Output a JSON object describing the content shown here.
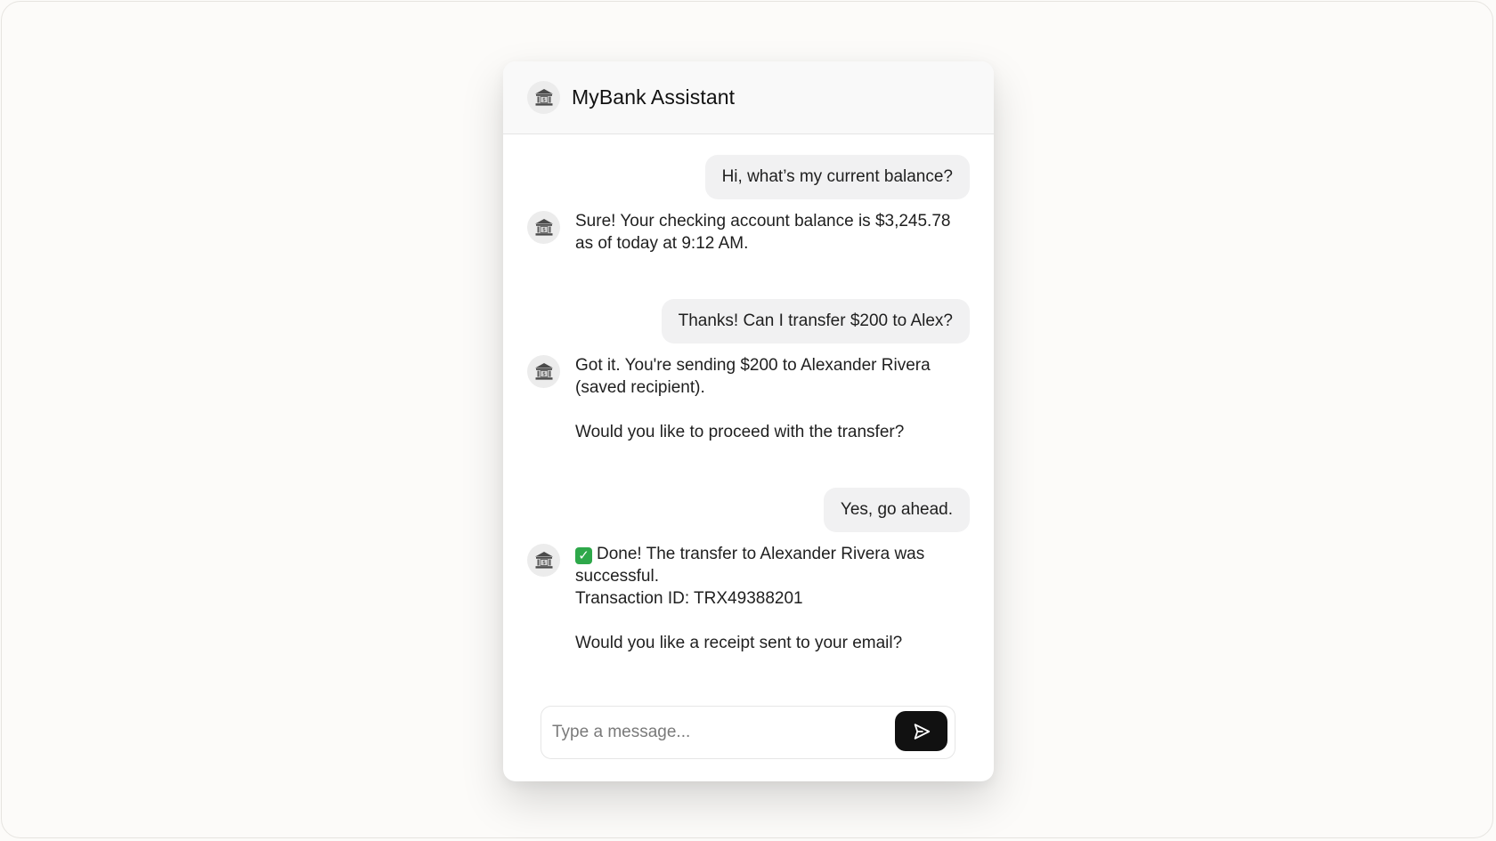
{
  "header": {
    "title": "MyBank Assistant",
    "avatar_icon": "bank-icon"
  },
  "messages": [
    {
      "role": "user",
      "text": "Hi, what’s my current balance?"
    },
    {
      "role": "assistant",
      "paragraphs": [
        "Sure! Your checking account balance is $3,245.78 as of today at 9:12 AM."
      ]
    },
    {
      "role": "user",
      "text": "Thanks! Can I transfer $200 to Alex?"
    },
    {
      "role": "assistant",
      "paragraphs": [
        "Got it. You're sending $200 to Alexander Rivera (saved recipient).",
        "Would you like to proceed with the transfer?"
      ]
    },
    {
      "role": "user",
      "text": "Yes, go ahead."
    },
    {
      "role": "assistant",
      "paragraphs": [
        "Done! The transfer to Alexander Rivera was successful.",
        "Transaction ID: TRX49388201",
        "Would you like a receipt sent to your email?"
      ],
      "leading_icon": "check-mark-icon"
    }
  ],
  "composer": {
    "placeholder": "Type a message...",
    "value": "",
    "send_icon": "send-icon"
  },
  "colors": {
    "send_button": "#111111",
    "user_bubble": "#f1f1f2",
    "check_mark": "#2ea84a"
  }
}
